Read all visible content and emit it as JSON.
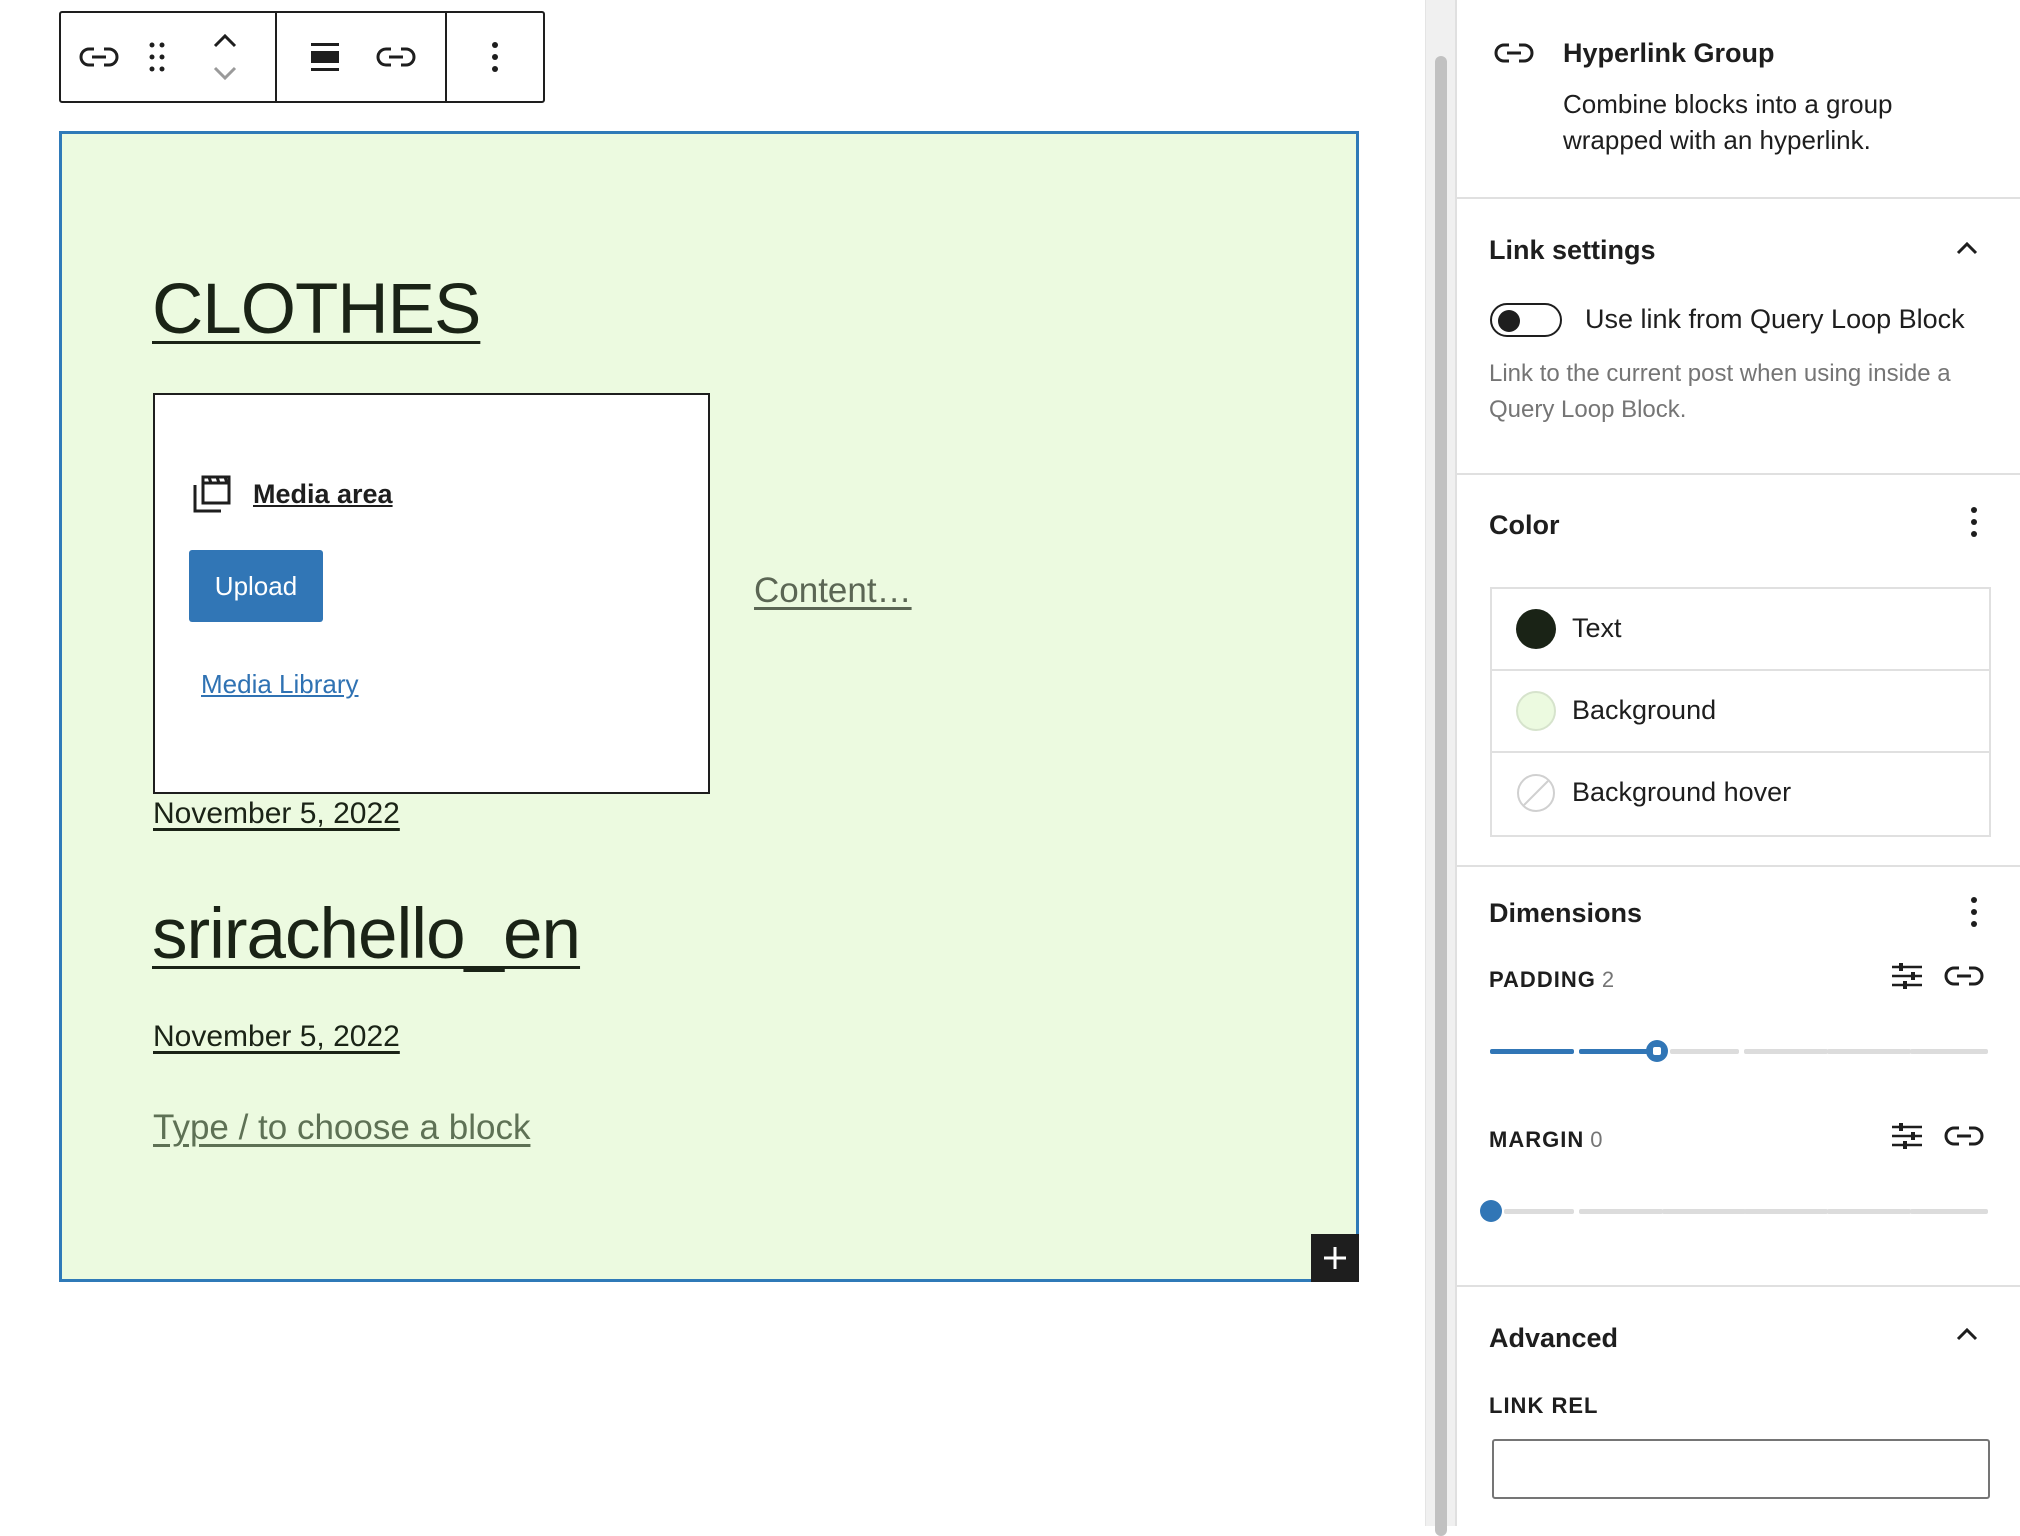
{
  "toolbar": {
    "buttons": [
      "hyperlink-group",
      "drag",
      "move-up",
      "move-down",
      "align",
      "link",
      "options"
    ]
  },
  "canvas": {
    "title1": "CLOTHES",
    "media": {
      "title": "Media area",
      "upload_label": "Upload",
      "library_label": "Media Library"
    },
    "content_placeholder": "Content…",
    "date1": "November 5, 2022",
    "title2": "srirachello_en",
    "date2": "November 5, 2022",
    "block_placeholder": "Type / to choose a block",
    "add_label": "+"
  },
  "sidebar": {
    "block_card": {
      "title": "Hyperlink Group",
      "description": "Combine blocks into a group wrapped with an hyperlink."
    },
    "link_settings": {
      "title": "Link settings",
      "toggle_label": "Use link from Query Loop Block",
      "toggle_on": false,
      "help": "Link to the current post when using inside a Query Loop Block."
    },
    "color": {
      "title": "Color",
      "items": [
        {
          "label": "Text",
          "color": "#1a2316"
        },
        {
          "label": "Background",
          "color": "#ecfae0"
        },
        {
          "label": "Background hover",
          "color": "none"
        }
      ]
    },
    "dimensions": {
      "title": "Dimensions",
      "padding_label": "PADDING",
      "padding_value": "2",
      "margin_label": "MARGIN",
      "margin_value": "0"
    },
    "advanced": {
      "title": "Advanced",
      "link_rel_label": "LINK REL",
      "link_rel_value": ""
    }
  },
  "colors": {
    "accent": "#3176b6",
    "block_bg": "#ecfae0",
    "text": "#1a2316"
  }
}
